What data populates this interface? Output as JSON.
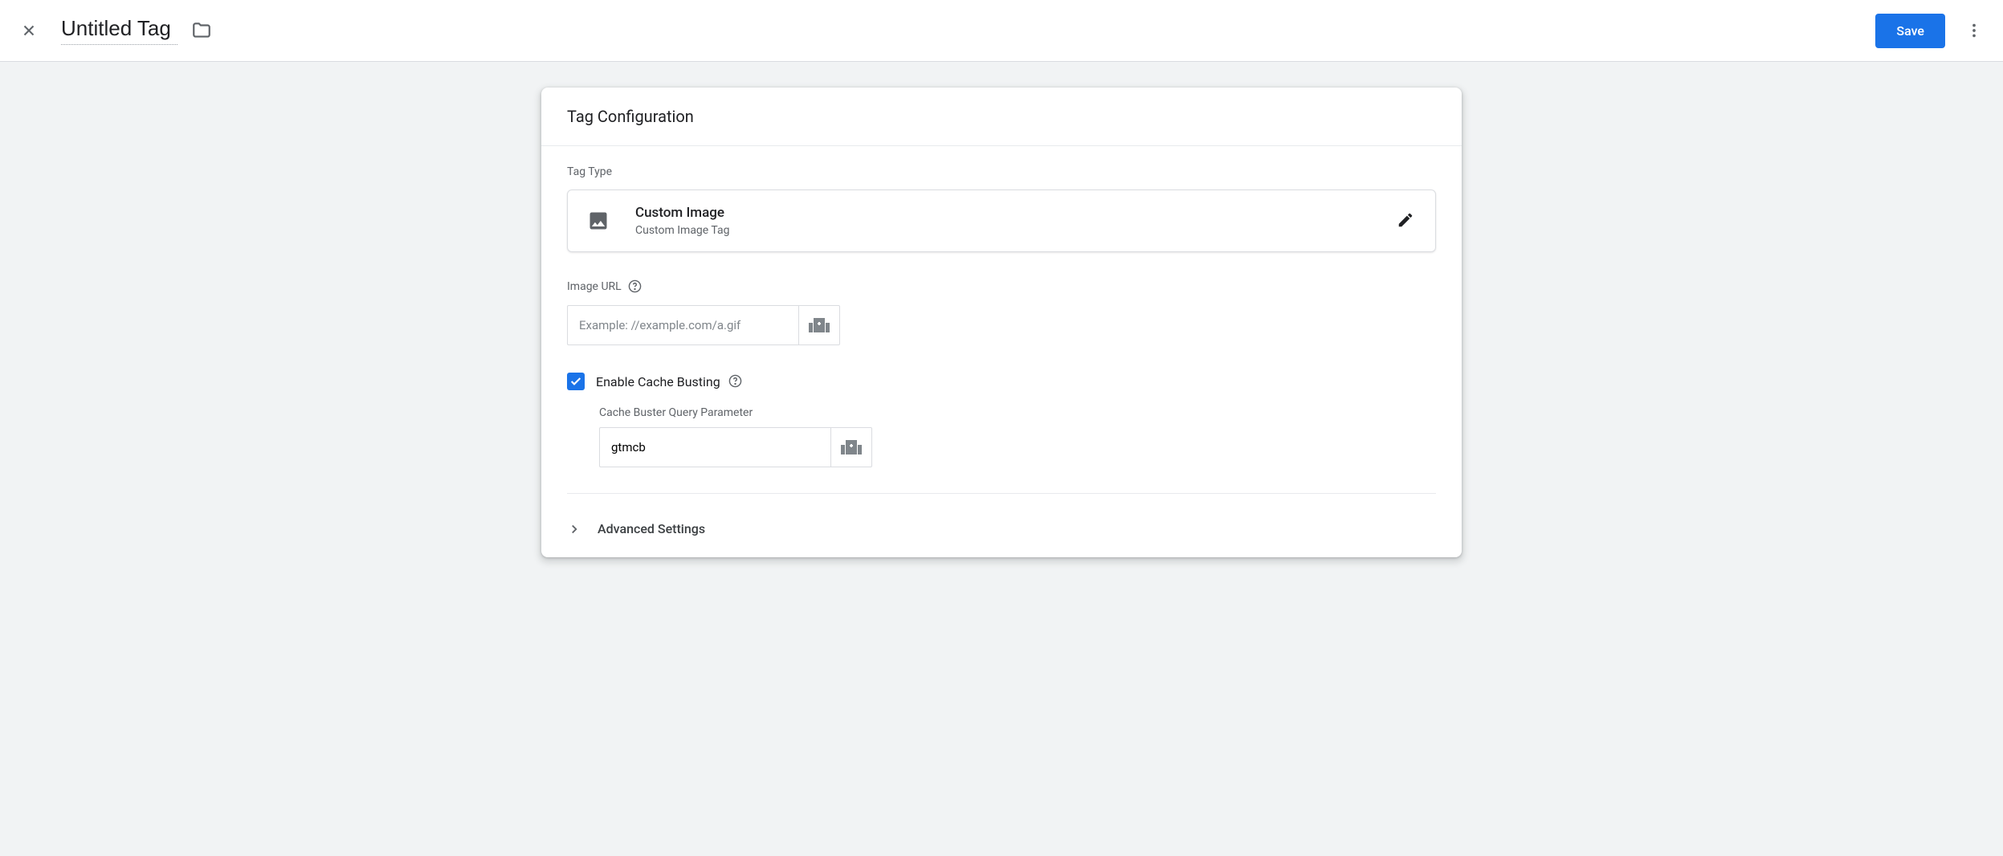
{
  "header": {
    "title": "Untitled Tag",
    "save_label": "Save"
  },
  "card": {
    "title": "Tag Configuration",
    "tag_type_label": "Tag Type",
    "tag_type": {
      "title": "Custom Image",
      "subtitle": "Custom Image Tag"
    },
    "image_url": {
      "label": "Image URL",
      "placeholder": "Example: //example.com/a.gif",
      "value": ""
    },
    "cache_busting": {
      "checkbox_label": "Enable Cache Busting",
      "checked": true,
      "param_label": "Cache Buster Query Parameter",
      "param_value": "gtmcb"
    },
    "advanced_label": "Advanced Settings"
  }
}
